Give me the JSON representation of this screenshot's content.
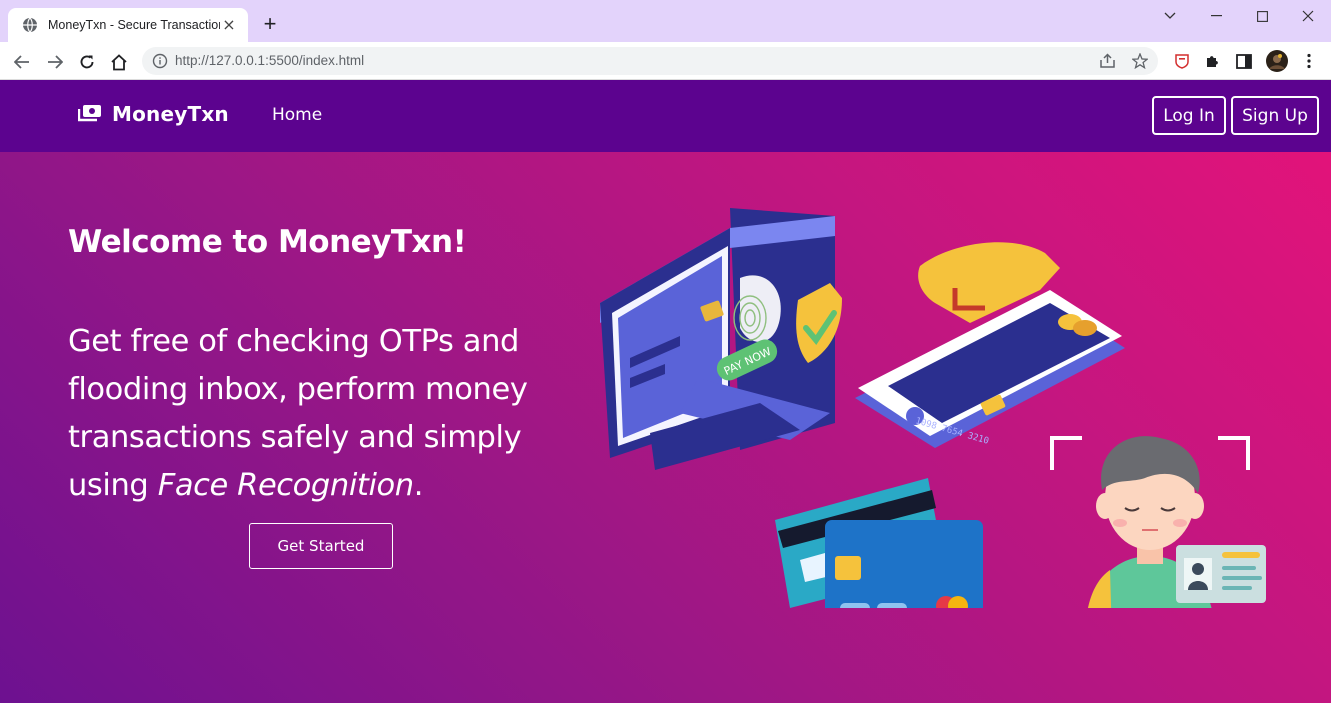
{
  "browser": {
    "tab_title": "MoneyTxn - Secure Transactions",
    "tab_close": "×",
    "new_tab": "+",
    "url": "http://127.0.0.1:5500/index.html"
  },
  "navbar": {
    "brand": "MoneyTxn",
    "home": "Home",
    "login": "Log In",
    "signup": "Sign Up"
  },
  "hero": {
    "title": "Welcome to MoneyTxn!",
    "lead_prefix": "Get free of checking OTPs and flooding inbox, perform money transactions safely and simply using ",
    "lead_emphasis": "Face Recognition",
    "lead_suffix": ".",
    "cta": "Get Started",
    "card_number": "1098 7654 3210",
    "pay_now": "PAY NOW"
  },
  "colors": {
    "navbar": "#5c038f",
    "gradient_start": "#e2137a",
    "gradient_end": "#6d1190",
    "titlebar": "#e3d3fb"
  }
}
